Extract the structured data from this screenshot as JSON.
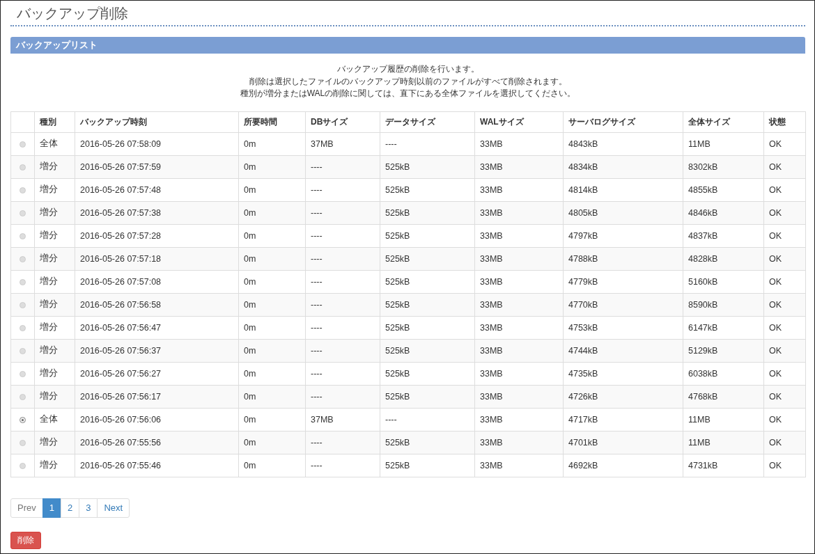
{
  "page_title": "バックアップ削除",
  "panel": {
    "title": "バックアップリスト",
    "description": [
      "バックアップ履歴の削除を行います。",
      "削除は選択したファイルのバックアップ時刻以前のファイルがすべて削除されます。",
      "種別が増分またはWALの削除に関しては、直下にある全体ファイルを選択してください。"
    ],
    "table": {
      "columns": [
        "種別",
        "バックアップ時刻",
        "所要時間",
        "DBサイズ",
        "データサイズ",
        "WALサイズ",
        "サーバログサイズ",
        "全体サイズ",
        "状態"
      ],
      "rows": [
        {
          "selected": false,
          "cells": [
            "全体",
            "2016-05-26 07:58:09",
            "0m",
            "37MB",
            "----",
            "33MB",
            "4843kB",
            "11MB",
            "OK"
          ]
        },
        {
          "selected": false,
          "cells": [
            "増分",
            "2016-05-26 07:57:59",
            "0m",
            "----",
            "525kB",
            "33MB",
            "4834kB",
            "8302kB",
            "OK"
          ]
        },
        {
          "selected": false,
          "cells": [
            "増分",
            "2016-05-26 07:57:48",
            "0m",
            "----",
            "525kB",
            "33MB",
            "4814kB",
            "4855kB",
            "OK"
          ]
        },
        {
          "selected": false,
          "cells": [
            "増分",
            "2016-05-26 07:57:38",
            "0m",
            "----",
            "525kB",
            "33MB",
            "4805kB",
            "4846kB",
            "OK"
          ]
        },
        {
          "selected": false,
          "cells": [
            "増分",
            "2016-05-26 07:57:28",
            "0m",
            "----",
            "525kB",
            "33MB",
            "4797kB",
            "4837kB",
            "OK"
          ]
        },
        {
          "selected": false,
          "cells": [
            "増分",
            "2016-05-26 07:57:18",
            "0m",
            "----",
            "525kB",
            "33MB",
            "4788kB",
            "4828kB",
            "OK"
          ]
        },
        {
          "selected": false,
          "cells": [
            "増分",
            "2016-05-26 07:57:08",
            "0m",
            "----",
            "525kB",
            "33MB",
            "4779kB",
            "5160kB",
            "OK"
          ]
        },
        {
          "selected": false,
          "cells": [
            "増分",
            "2016-05-26 07:56:58",
            "0m",
            "----",
            "525kB",
            "33MB",
            "4770kB",
            "8590kB",
            "OK"
          ]
        },
        {
          "selected": false,
          "cells": [
            "増分",
            "2016-05-26 07:56:47",
            "0m",
            "----",
            "525kB",
            "33MB",
            "4753kB",
            "6147kB",
            "OK"
          ]
        },
        {
          "selected": false,
          "cells": [
            "増分",
            "2016-05-26 07:56:37",
            "0m",
            "----",
            "525kB",
            "33MB",
            "4744kB",
            "5129kB",
            "OK"
          ]
        },
        {
          "selected": false,
          "cells": [
            "増分",
            "2016-05-26 07:56:27",
            "0m",
            "----",
            "525kB",
            "33MB",
            "4735kB",
            "6038kB",
            "OK"
          ]
        },
        {
          "selected": false,
          "cells": [
            "増分",
            "2016-05-26 07:56:17",
            "0m",
            "----",
            "525kB",
            "33MB",
            "4726kB",
            "4768kB",
            "OK"
          ]
        },
        {
          "selected": true,
          "cells": [
            "全体",
            "2016-05-26 07:56:06",
            "0m",
            "37MB",
            "----",
            "33MB",
            "4717kB",
            "11MB",
            "OK"
          ]
        },
        {
          "selected": false,
          "cells": [
            "増分",
            "2016-05-26 07:55:56",
            "0m",
            "----",
            "525kB",
            "33MB",
            "4701kB",
            "11MB",
            "OK"
          ]
        },
        {
          "selected": false,
          "cells": [
            "増分",
            "2016-05-26 07:55:46",
            "0m",
            "----",
            "525kB",
            "33MB",
            "4692kB",
            "4731kB",
            "OK"
          ]
        }
      ]
    }
  },
  "pagination": {
    "prev": {
      "label": "Prev",
      "disabled": true
    },
    "pages": [
      {
        "label": "1",
        "selected": true
      },
      {
        "label": "2",
        "selected": false
      },
      {
        "label": "3",
        "selected": false
      }
    ],
    "next": {
      "label": "Next",
      "disabled": false
    }
  },
  "delete_button": "削除"
}
